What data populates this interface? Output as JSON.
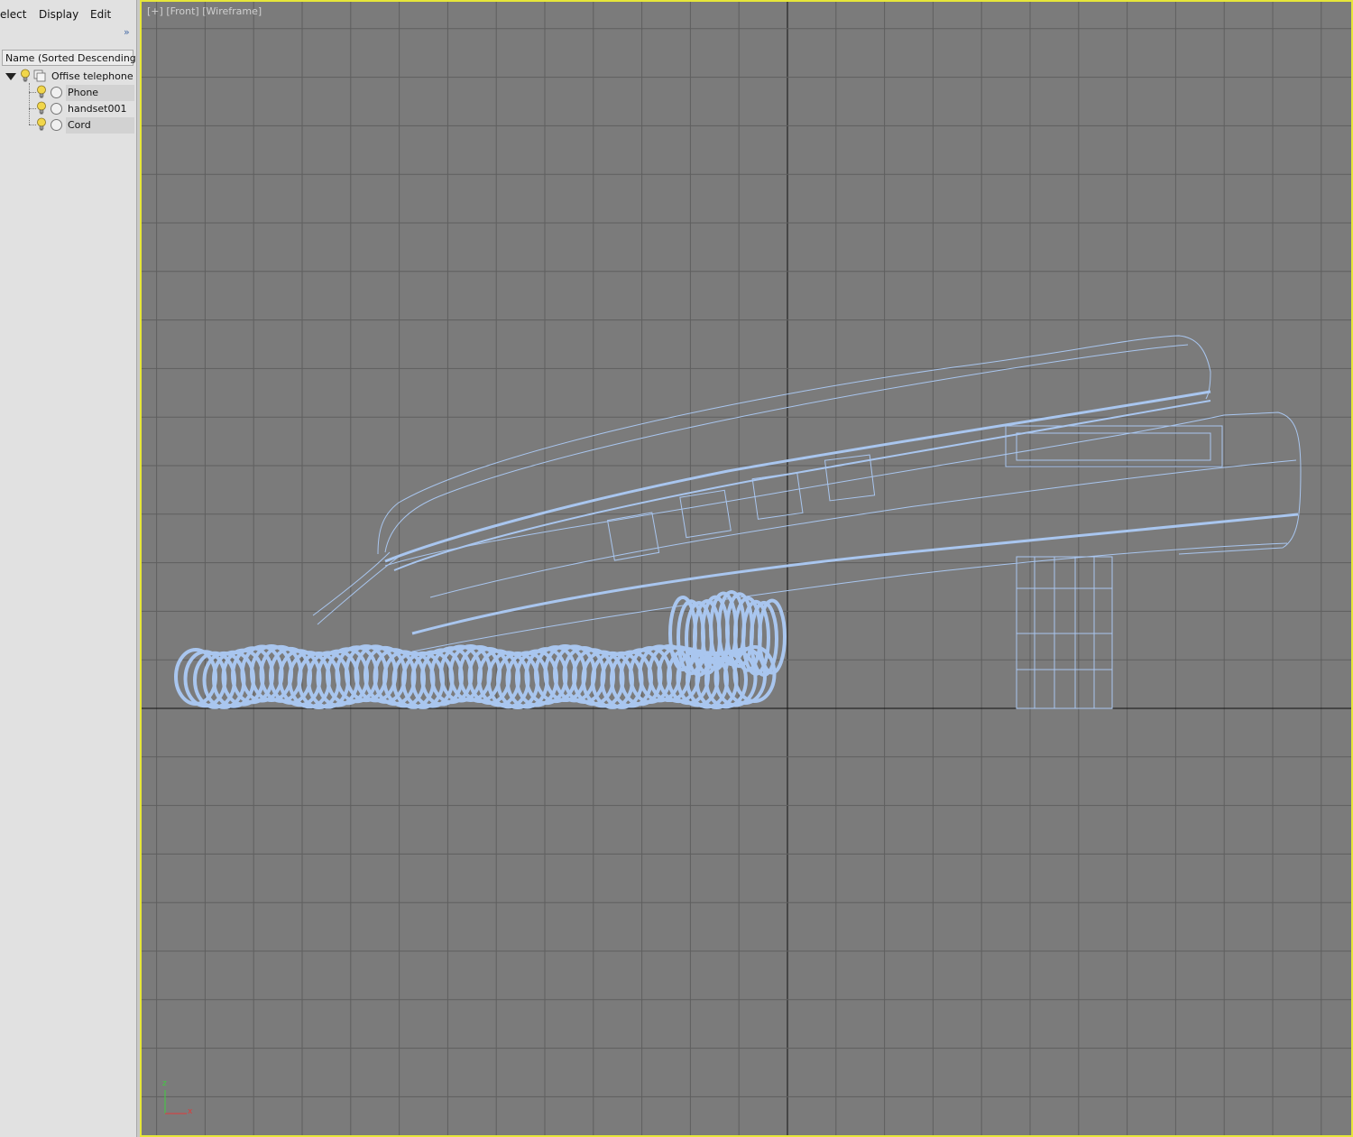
{
  "menubar": {
    "select_label": "elect",
    "display_label": "Display",
    "edit_label": "Edit",
    "expand_label": "»"
  },
  "scene_explorer": {
    "column_header": "Name (Sorted Descending)",
    "items": [
      {
        "label": "Offise telephone"
      },
      {
        "label": "Phone"
      },
      {
        "label": "handset001"
      },
      {
        "label": "Cord"
      }
    ]
  },
  "viewport": {
    "label_plus": "[+]",
    "label_view": "[Front]",
    "label_shading": "[Wireframe]",
    "axis_x": "x",
    "axis_z": "z"
  },
  "colors": {
    "viewport_bg": "#7b7b7b",
    "grid_line": "#5f5f5f",
    "grid_axis": "#111111",
    "wireframe": "#a9c6ef",
    "viewport_border": "#e6e639"
  }
}
